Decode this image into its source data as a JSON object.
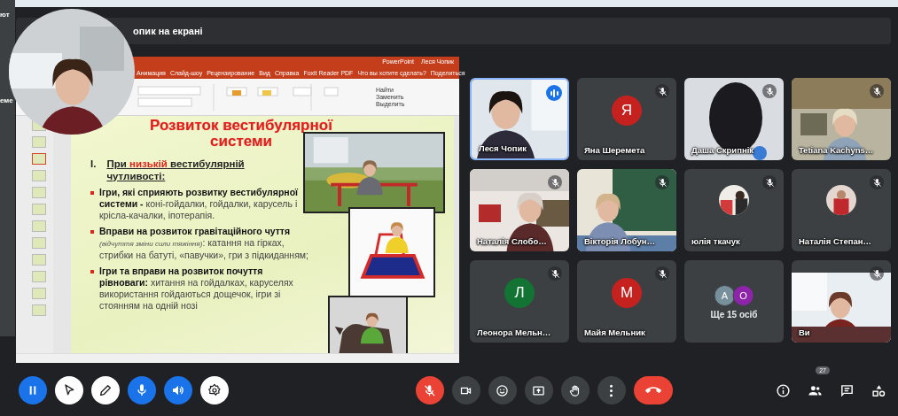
{
  "edge_texts": [
    "ют",
    "еме"
  ],
  "header": {
    "title": "опик на екрані"
  },
  "ppt": {
    "app": "PowerPoint",
    "user": "Леся Чопик",
    "tabs": [
      "Анимация",
      "Слайд-шоу",
      "Рецензирование",
      "Вид",
      "Справка",
      "Foxit Reader PDF"
    ],
    "tell_me": "Что вы хотите сделать?",
    "share": "Поделиться",
    "edit_commands": [
      "Найти",
      "Заменить",
      "Выделить"
    ],
    "thumbnails": [
      {
        "selected": false
      },
      {
        "selected": false
      },
      {
        "selected": true
      },
      {
        "selected": false
      },
      {
        "selected": false
      },
      {
        "selected": false
      },
      {
        "selected": false
      },
      {
        "selected": false
      },
      {
        "selected": false
      },
      {
        "selected": false
      },
      {
        "selected": false
      },
      {
        "selected": false
      }
    ],
    "slide": {
      "title": "Розвиток вестибулярної системи",
      "heading_number": "I.",
      "heading_parts": [
        {
          "text": "При ",
          "emphasis": false
        },
        {
          "text": "низькій",
          "emphasis": true
        },
        {
          "text": " вестибулярній чутливості:",
          "emphasis": false
        }
      ],
      "bullets": [
        "**Ігри, які сприяють розвитку вестибулярної системи -** коні-гойдалки, гойдалки, карусель і крісла-качалки, іпотерапія.",
        "**Вправи на розвиток гравітаційного чуття** *(відчуття зміни сили тяжіння)*: катання на гірках, стрибки на батуті, «павучки», гри з підкиданням;",
        "**Ігри та вправи на розвиток почуття рівноваги:** хитання на гойдалках, каруселях використання гойдаються дощечок, ігри зі стоянням на одній нозі"
      ],
      "pictures": [
        {
          "kind": "picture"
        },
        {
          "kind": "picture"
        },
        {
          "kind": "picture"
        }
      ]
    }
  },
  "tiles": [
    {
      "name": "Леся Чопик",
      "kind": "video",
      "muted": false,
      "speaking": true
    },
    {
      "name": "Яна Шеремета",
      "kind": "initial",
      "initial": "Я",
      "color": "#c5221f",
      "muted": true,
      "speaking": false
    },
    {
      "name": "Даша Скрипнік",
      "kind": "video",
      "muted": true,
      "speaking": false
    },
    {
      "name": "Tetiana Kachyns…",
      "kind": "video",
      "muted": true,
      "speaking": false
    },
    {
      "name": "Наталія Слобо…",
      "kind": "video",
      "muted": true,
      "speaking": false
    },
    {
      "name": "Вікторія Лобун…",
      "kind": "video",
      "muted": true,
      "speaking": false
    },
    {
      "name": "юлія ткачук",
      "muted": true,
      "speaking": false
    },
    {
      "name": "Наталія Степан…",
      "muted": true,
      "speaking": false
    },
    {
      "name": "Леонора Мельн…",
      "kind": "initial",
      "initial": "Л",
      "color": "#137333",
      "muted": true,
      "speaking": false
    },
    {
      "name": "Майя Мельник",
      "kind": "initial",
      "initial": "М",
      "color": "#c5221f",
      "muted": true,
      "speaking": false
    },
    {
      "name": "Ще 15 осіб",
      "kind": "more",
      "muted": false,
      "speaking": false,
      "avatars": [
        {
          "initial": "А",
          "color": "#78909c"
        },
        {
          "initial": "О",
          "color": "#8e24aa"
        }
      ]
    },
    {
      "name": "Ви",
      "kind": "video",
      "muted": true,
      "speaking": false
    }
  ],
  "annotation_tools": [
    {
      "kind": "pause",
      "active": true
    },
    {
      "kind": "pointer",
      "active": false
    },
    {
      "kind": "pen",
      "active": false
    },
    {
      "kind": "mic",
      "active": true
    },
    {
      "kind": "speaker",
      "active": true
    },
    {
      "kind": "settings",
      "active": false
    }
  ],
  "call_controls": [
    {
      "kind": "mic",
      "on": false
    },
    {
      "kind": "camera",
      "on": true
    },
    {
      "kind": "emoji"
    },
    {
      "kind": "present"
    },
    {
      "kind": "hand"
    },
    {
      "kind": "more"
    },
    {
      "kind": "end-call"
    }
  ],
  "side_controls": [
    {
      "kind": "info"
    },
    {
      "kind": "people",
      "badge": "27"
    },
    {
      "kind": "chat"
    },
    {
      "kind": "activities"
    }
  ]
}
